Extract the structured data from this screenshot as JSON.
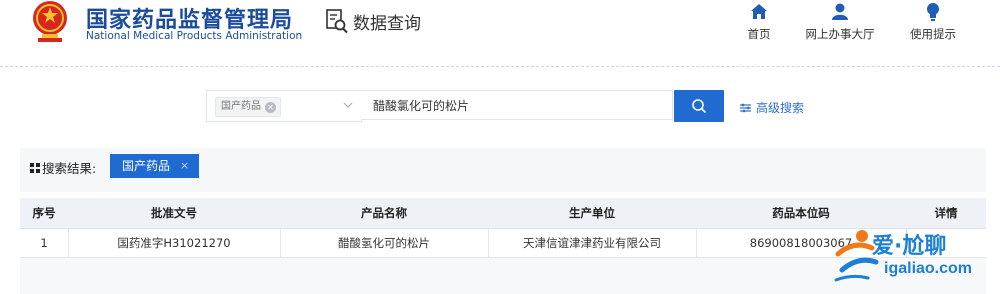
{
  "header": {
    "title": "国家药品监督管理局",
    "subtitle": "National Medical Products Administration",
    "section_title": "数据查询",
    "nav": [
      {
        "label": "首页",
        "icon": "home-icon"
      },
      {
        "label": "网上办事大厅",
        "icon": "user-icon"
      },
      {
        "label": "使用提示",
        "icon": "lightbulb-icon"
      }
    ]
  },
  "search": {
    "category_tag": "国产药品",
    "query": "醋酸氯化可的松片",
    "advanced_label": "高级搜索"
  },
  "results": {
    "label": "搜索结果:",
    "tag": "国产药品",
    "tag_close": "×"
  },
  "table": {
    "columns": [
      "序号",
      "批准文号",
      "产品名称",
      "生产单位",
      "药品本位码",
      "详情"
    ],
    "rows": [
      [
        "1",
        "国药准字H31021270",
        "醋酸氢化可的松片",
        "天津信谊津津药业有限公司",
        "86900818003067",
        ""
      ]
    ]
  },
  "watermark": {
    "text": "爱·尬聊",
    "url": "igaliao.com"
  },
  "colors": {
    "brand_blue": "#1b4c9c",
    "accent_blue": "#1f6bd1"
  }
}
